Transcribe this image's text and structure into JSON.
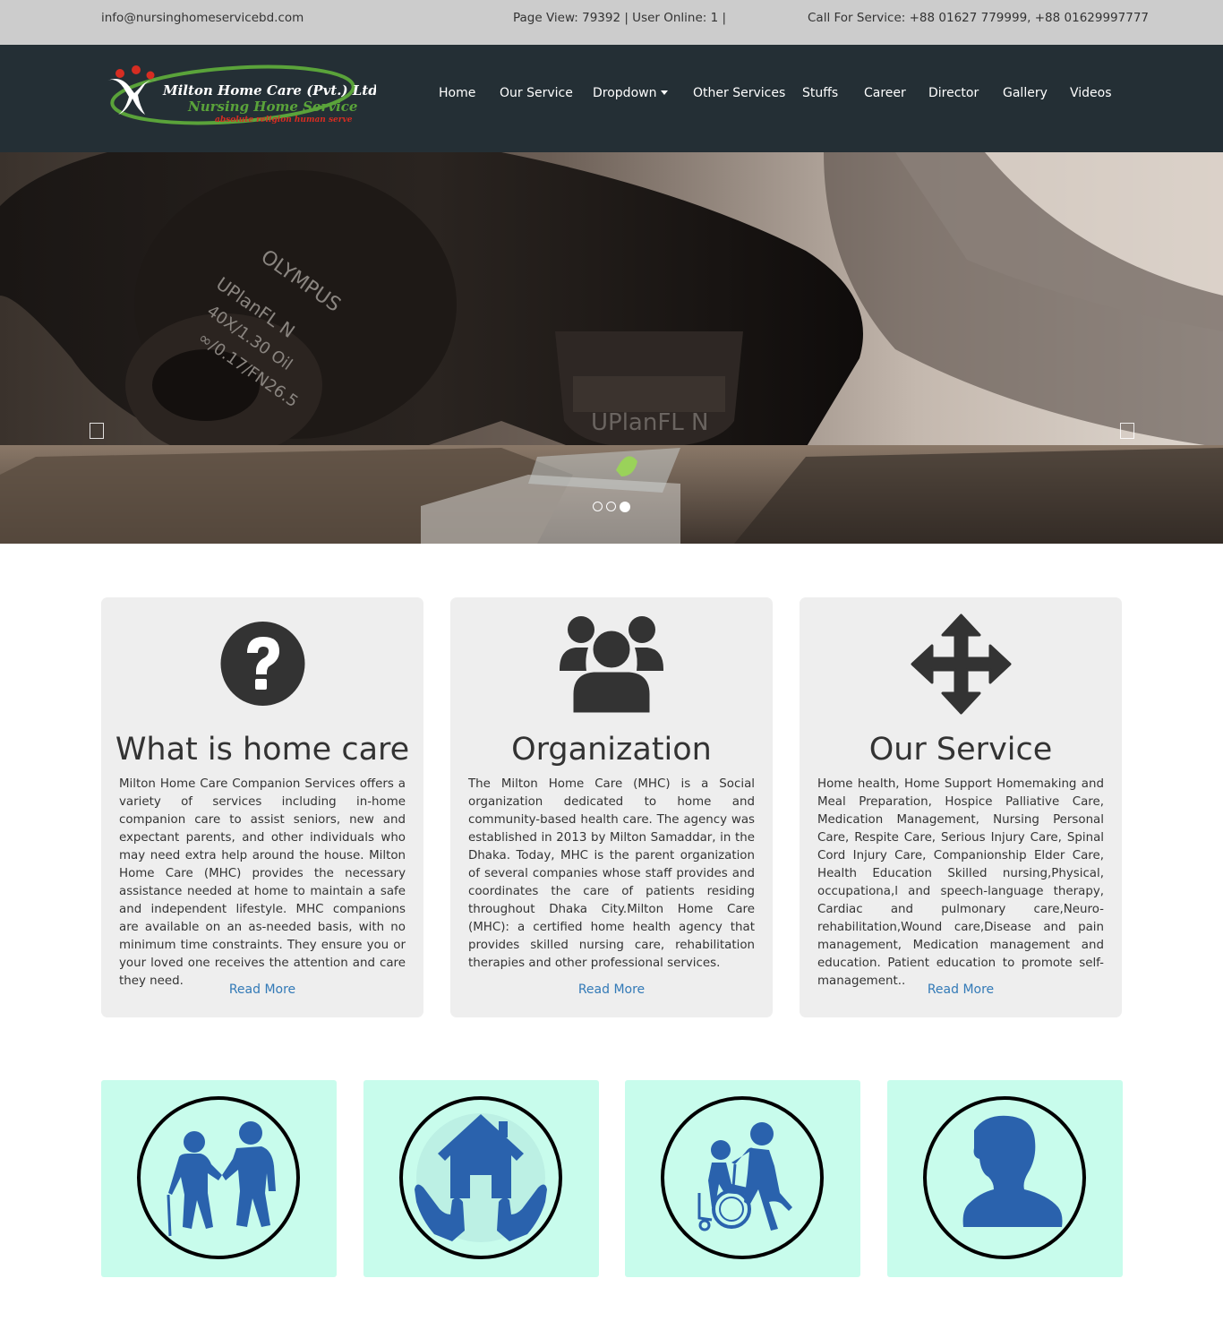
{
  "topbar": {
    "email": "info@nursinghomeservicebd.com",
    "stats": "Page View: 79392 | User Online: 1 |",
    "phone": "Call For Service: +88 01627 779999, +88 01629997777"
  },
  "logo": {
    "line1": "Milton Home Care (Pvt.) Ltd.",
    "line2": "Nursing Home Service",
    "tagline": "absolute religion human serve"
  },
  "nav": {
    "items": [
      "Home",
      "Our Service",
      "Dropdown",
      "Other Services",
      "Stuffs",
      "Career",
      "Director",
      "Gallery",
      "Videos"
    ]
  },
  "hero": {
    "prev_icon": "chevron-left-icon",
    "next_icon": "chevron-right-icon",
    "slide_count": 3,
    "active_slide": 3
  },
  "cards": [
    {
      "icon": "question-circle-icon",
      "title": "What is home care",
      "text": "Milton Home Care Companion Services offers a variety of services including in-home companion care to assist seniors, new and expectant parents, and other individuals who may need extra help around the house. Milton Home Care (MHC) provides the necessary assistance needed at home to maintain a safe and independent lifestyle. MHC companions are available on an as-needed basis, with no minimum time constraints. They ensure you or your loved one receives the attention and care they need.",
      "link": "Read More"
    },
    {
      "icon": "users-icon",
      "title": "Organization",
      "text": "The Milton Home Care (MHC) is a Social organization dedicated to home and community-based health care. The agency was established in 2013 by Milton Samaddar, in the Dhaka. Today, MHC is the parent organization of several companies whose staff provides and coordinates the care of patients residing throughout Dhaka City.Milton Home Care (MHC): a certified home health agency that provides skilled nursing care, rehabilitation therapies and other professional services.",
      "link": "Read More"
    },
    {
      "icon": "move-arrows-icon",
      "title": "Our Service",
      "text": "Home health, Home Support Homemaking and Meal Preparation, Hospice Palliative Care, Medication Management, Nursing Personal Care, Respite Care, Serious Injury Care, Spinal Cord Injury Care, Companionship Elder Care, Health Education Skilled nursing,Physical, occupationa,l and speech-language therapy, Cardiac and pulmonary care,Neuro-rehabilitation,Wound care,Disease and pain management, Medication management and education. Patient education to promote self-management..",
      "link": "Read More"
    }
  ],
  "tiles": [
    {
      "icon": "elderly-couple-icon"
    },
    {
      "icon": "home-care-hands-icon"
    },
    {
      "icon": "wheelchair-assist-icon"
    },
    {
      "icon": "person-silhouette-icon"
    }
  ],
  "colors": {
    "topbar_bg": "#cccccc",
    "navbar_bg": "#242f35",
    "card_bg": "#eeeeee",
    "link": "#337ab7",
    "tile_bg": "#c8fcec",
    "tile_icon": "#2a62ad",
    "logo_green": "#5aa33a",
    "logo_red": "#d62d22"
  }
}
